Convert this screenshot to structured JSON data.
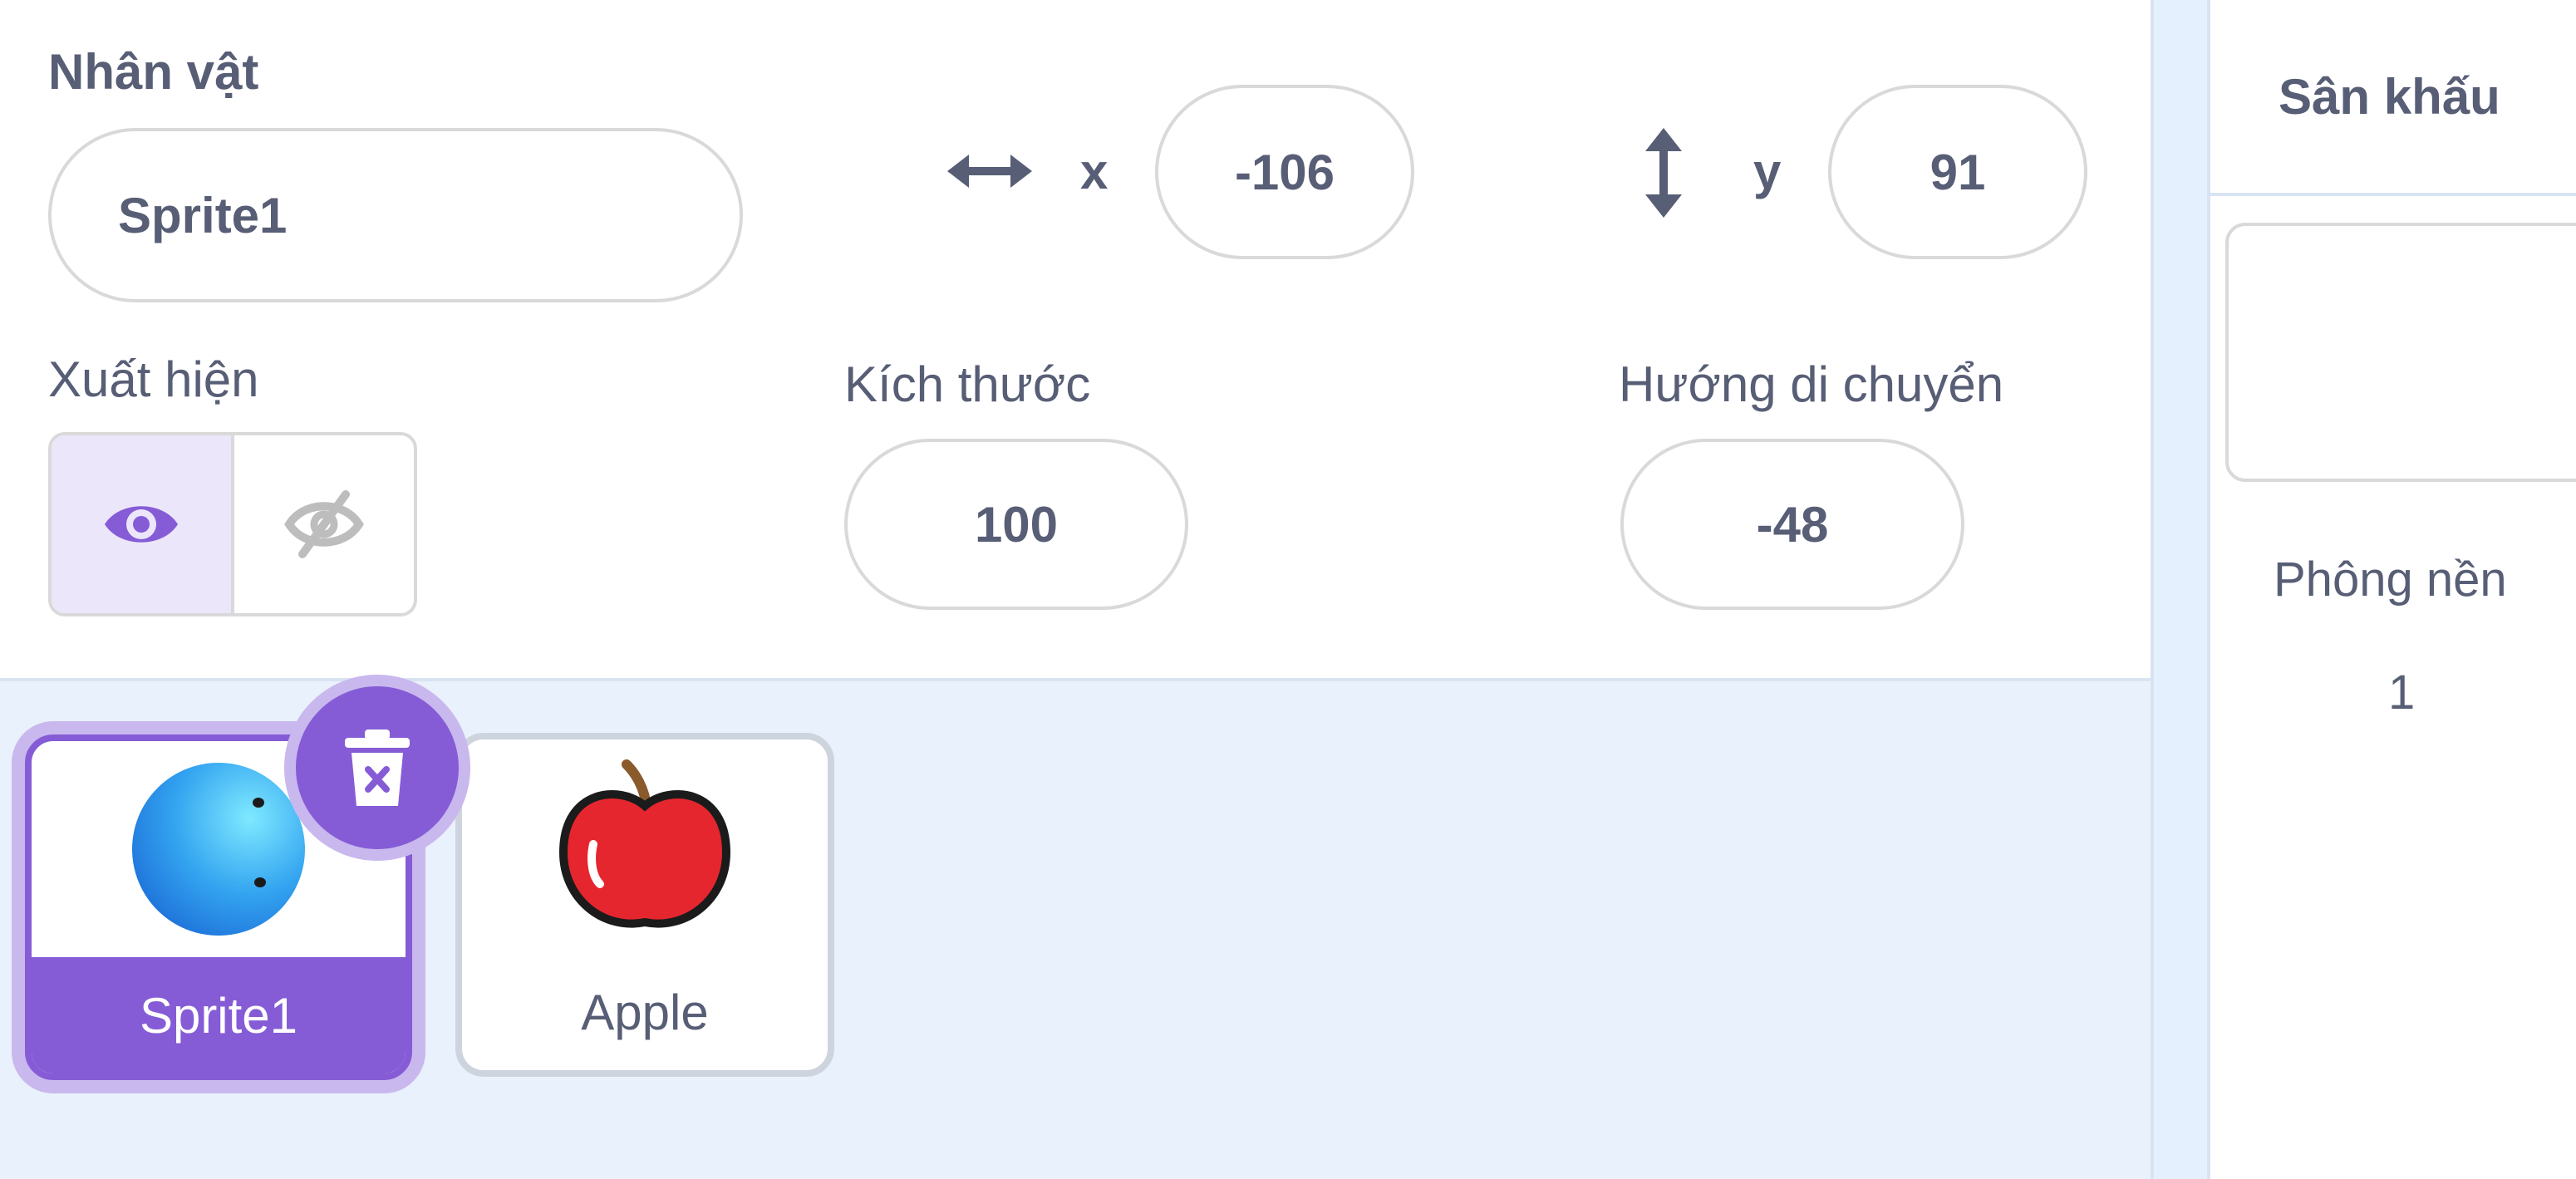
{
  "sprite_info": {
    "sprite_label": "Nhân vật",
    "sprite_name": "Sprite1",
    "x_label": "x",
    "x_value": "-106",
    "y_label": "y",
    "y_value": "91",
    "show_label": "Xuất hiện",
    "show_state": "visible",
    "size_label": "Kích thước",
    "size_value": "100",
    "direction_label": "Hướng di chuyển",
    "direction_value": "-48"
  },
  "sprite_list": {
    "items": [
      {
        "name": "Sprite1",
        "selected": true,
        "icon": "blue-ball-icon"
      },
      {
        "name": "Apple",
        "selected": false,
        "icon": "apple-icon"
      }
    ]
  },
  "stage": {
    "title": "Sân khấu",
    "backdrops_label": "Phông nền",
    "backdrops_count": "1"
  },
  "colors": {
    "accent": "#855cd6",
    "accent_light": "#c9b8ee",
    "text": "#575e75",
    "list_bg": "#e9f1fc"
  }
}
